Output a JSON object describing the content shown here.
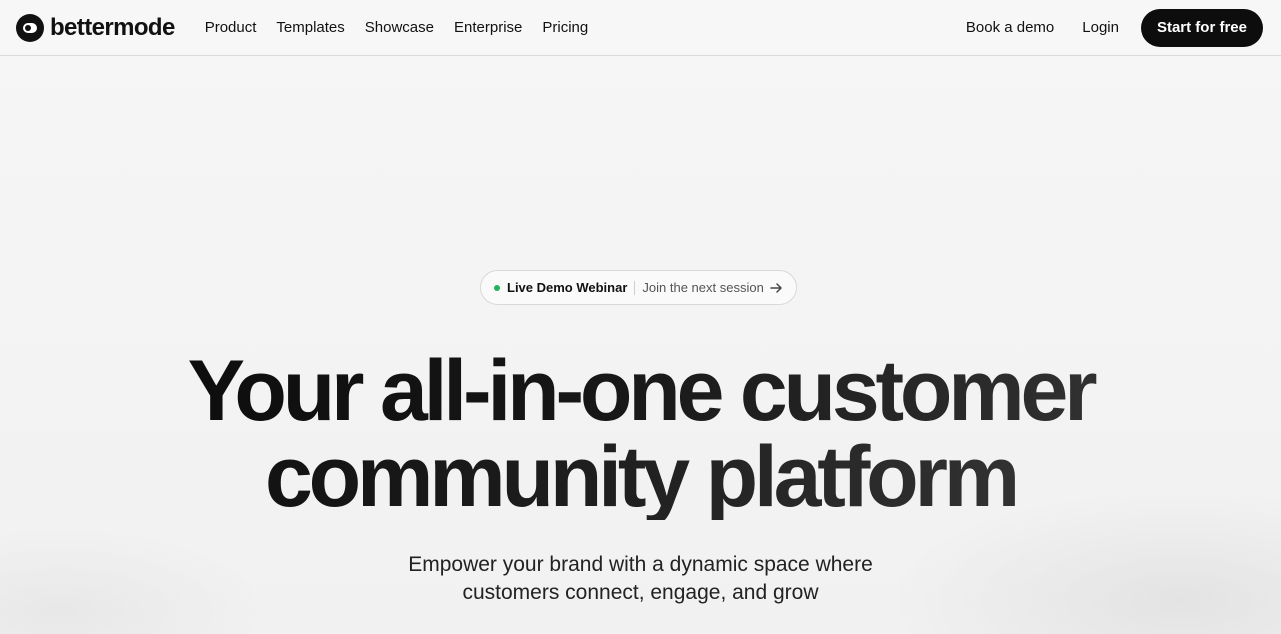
{
  "brand": {
    "name": "bettermode"
  },
  "nav": {
    "items": [
      "Product",
      "Templates",
      "Showcase",
      "Enterprise",
      "Pricing"
    ]
  },
  "header_actions": {
    "book_demo": "Book a demo",
    "login": "Login",
    "start": "Start for free"
  },
  "webinar": {
    "label": "Live Demo Webinar",
    "link": "Join the next session",
    "status_color": "#22b35b",
    "icon": "arrow-right-icon"
  },
  "hero": {
    "line1": "Your all-in-one customer",
    "line2": "community platform",
    "sub_line1": "Empower your brand with a dynamic space where",
    "sub_line2": "customers connect, engage, and grow"
  },
  "colors": {
    "cta_bg": "#0d0d0d",
    "page_bg": "#f4f4f4"
  }
}
